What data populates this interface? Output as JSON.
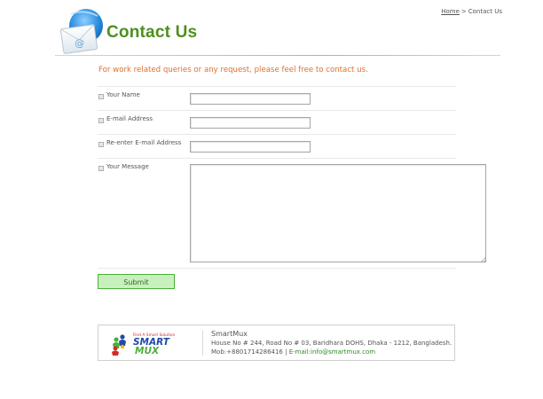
{
  "breadcrumb": {
    "home_label": "Home",
    "separator": ">",
    "current_label": "Contact Us"
  },
  "header": {
    "title": "Contact Us",
    "icon": "email-envelope-icon",
    "title_color": "#4f8f1e"
  },
  "intro": {
    "text": "For work related queries or any request, please feel free to contact us.",
    "color": "#e0702a"
  },
  "form": {
    "fields": [
      {
        "label": "Your Name",
        "value": ""
      },
      {
        "label": "E-mail Address",
        "value": ""
      },
      {
        "label": "Re-enter E-mail Address",
        "value": ""
      },
      {
        "label": "Your Message",
        "value": ""
      }
    ],
    "submit_label": "Submit"
  },
  "footer": {
    "logo": {
      "tagline": "Find A Smart Solution",
      "word1": "SMART",
      "word2": "MUX",
      "icon": "people-cluster-logo-icon"
    },
    "company_name": "SmartMux",
    "address": "House No # 244, Road No # 03, Baridhara DOHS, Dhaka - 1212, Bangladesh.",
    "phone": "Mob:+8801714286416",
    "separator": "|",
    "email": "E-mail:info@smartmux.com"
  },
  "colors": {
    "accent_green": "#4f8f1e",
    "intro_orange": "#e0702a",
    "button_bg": "#c8f0bf",
    "button_border": "#4caf3a",
    "logo_blue": "#1f4aa8",
    "logo_green": "#4caf3a",
    "logo_red": "#d42a2a"
  }
}
